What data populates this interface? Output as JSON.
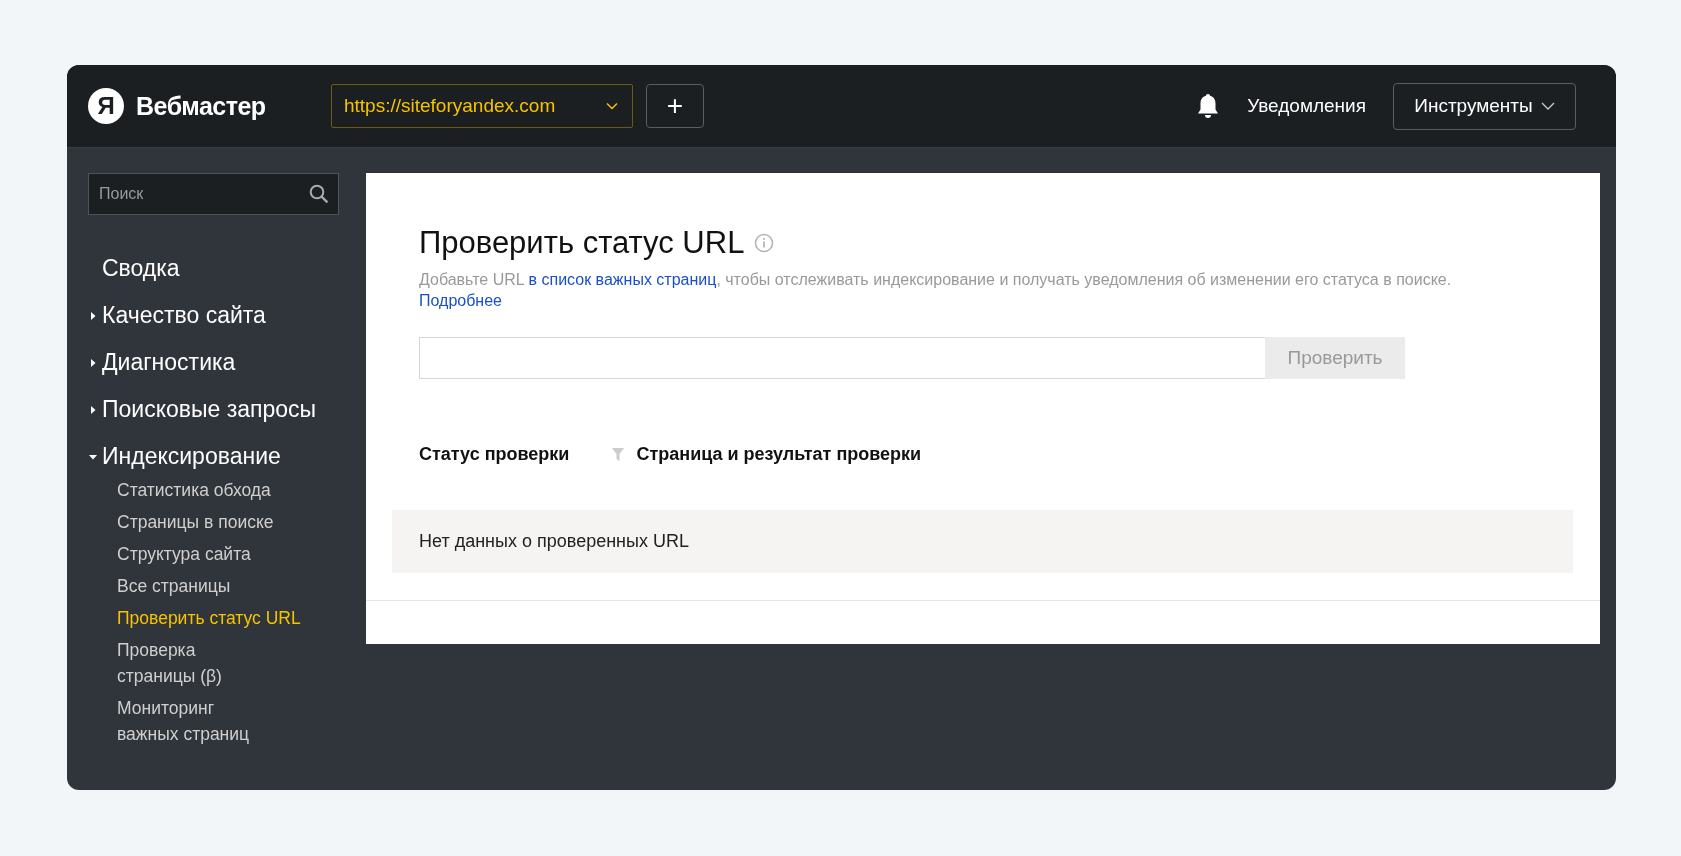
{
  "header": {
    "logo_letter": "Я",
    "brand": "Вебмастер",
    "site_select": "https://siteforyandex.com",
    "add_button": "+",
    "notifications": "Уведомления",
    "tools_button": "Инструменты"
  },
  "sidebar": {
    "search": {
      "placeholder": "Поиск"
    },
    "items": [
      {
        "kind": "link",
        "label": "Сводка"
      },
      {
        "kind": "group",
        "label": "Качество сайта",
        "expanded": false
      },
      {
        "kind": "group",
        "label": "Диагностика",
        "expanded": false
      },
      {
        "kind": "group",
        "label": "Поисковые запросы",
        "expanded": false
      },
      {
        "kind": "group",
        "label": "Индексирование",
        "expanded": true,
        "children": [
          {
            "label": "Статистика обхода",
            "selected": false
          },
          {
            "label": "Страницы в поиске",
            "selected": false
          },
          {
            "label": "Структура сайта",
            "selected": false
          },
          {
            "label": "Все страницы",
            "selected": false
          },
          {
            "label": "Проверить статус URL",
            "selected": true
          },
          {
            "label": "Проверка\nстраницы (β)",
            "selected": false
          },
          {
            "label": "Мониторинг\nважных страниц",
            "selected": false
          }
        ]
      }
    ]
  },
  "main": {
    "title": "Проверить статус URL",
    "description_before": "Добавьте URL",
    "description_link": "в список важных страниц",
    "description_after": ", чтобы отслеживать индексирование и получать уведомления об изменении его статуса в поиске.",
    "more_link": "Подробнее",
    "check_button": "Проверить",
    "table": {
      "columns": [
        "Статус проверки",
        "Страница и результат проверки"
      ],
      "empty_message": "Нет данных о проверенных URL"
    }
  }
}
